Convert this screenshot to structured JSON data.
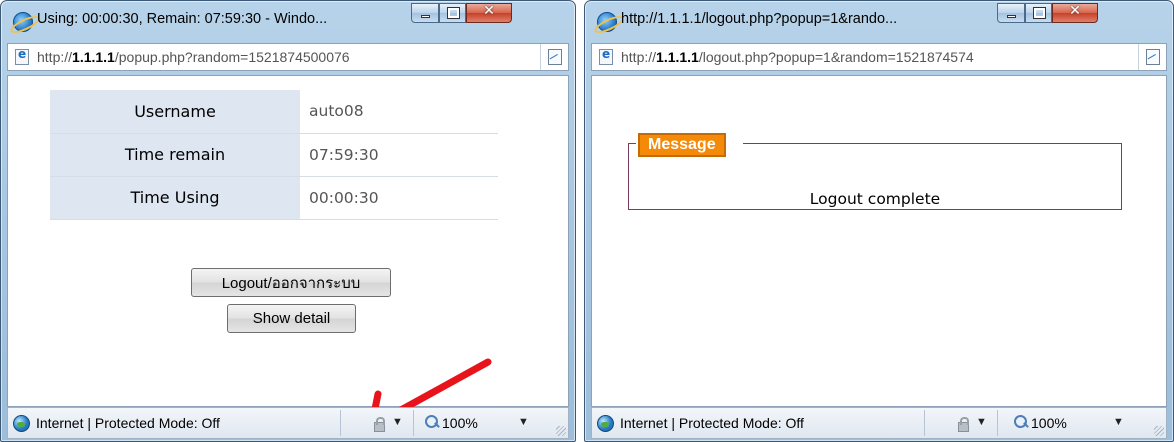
{
  "windows": [
    {
      "title": "Using: 00:00:30, Remain: 07:59:30 - Windo...",
      "url_prefix": "http://",
      "url_host": "1.1.1.1",
      "url_path": "/popup.php?random=1521874500076",
      "info": [
        {
          "label": "Username",
          "value": "auto08"
        },
        {
          "label": "Time remain",
          "value": "07:59:30"
        },
        {
          "label": "Time Using",
          "value": "00:00:30"
        }
      ],
      "buttons": {
        "logout": "Logout/ออกจากระบบ",
        "detail": "Show detail"
      },
      "status": "Internet | Protected Mode: Off",
      "zoom": "100%"
    },
    {
      "title": "http://1.1.1.1/logout.php?popup=1&rando...",
      "url_prefix": "http://",
      "url_host": "1.1.1.1",
      "url_path": "/logout.php?popup=1&random=1521874574",
      "legend": "Message",
      "message": "Logout complete",
      "status": "Internet | Protected Mode: Off",
      "zoom": "100%"
    }
  ],
  "colors": {
    "legend_bg": "#f48a07",
    "fieldset_border": "#7b3b62",
    "label_bg": "#dde6f1",
    "annotation_arrow": "#e8141b"
  },
  "icons": {
    "browser": "ie-logo-icon",
    "page": "page-icon",
    "compat": "compatibility-view-icon",
    "zone": "globe-icon",
    "protected": "lock-icon",
    "zoom": "magnifier-icon"
  }
}
